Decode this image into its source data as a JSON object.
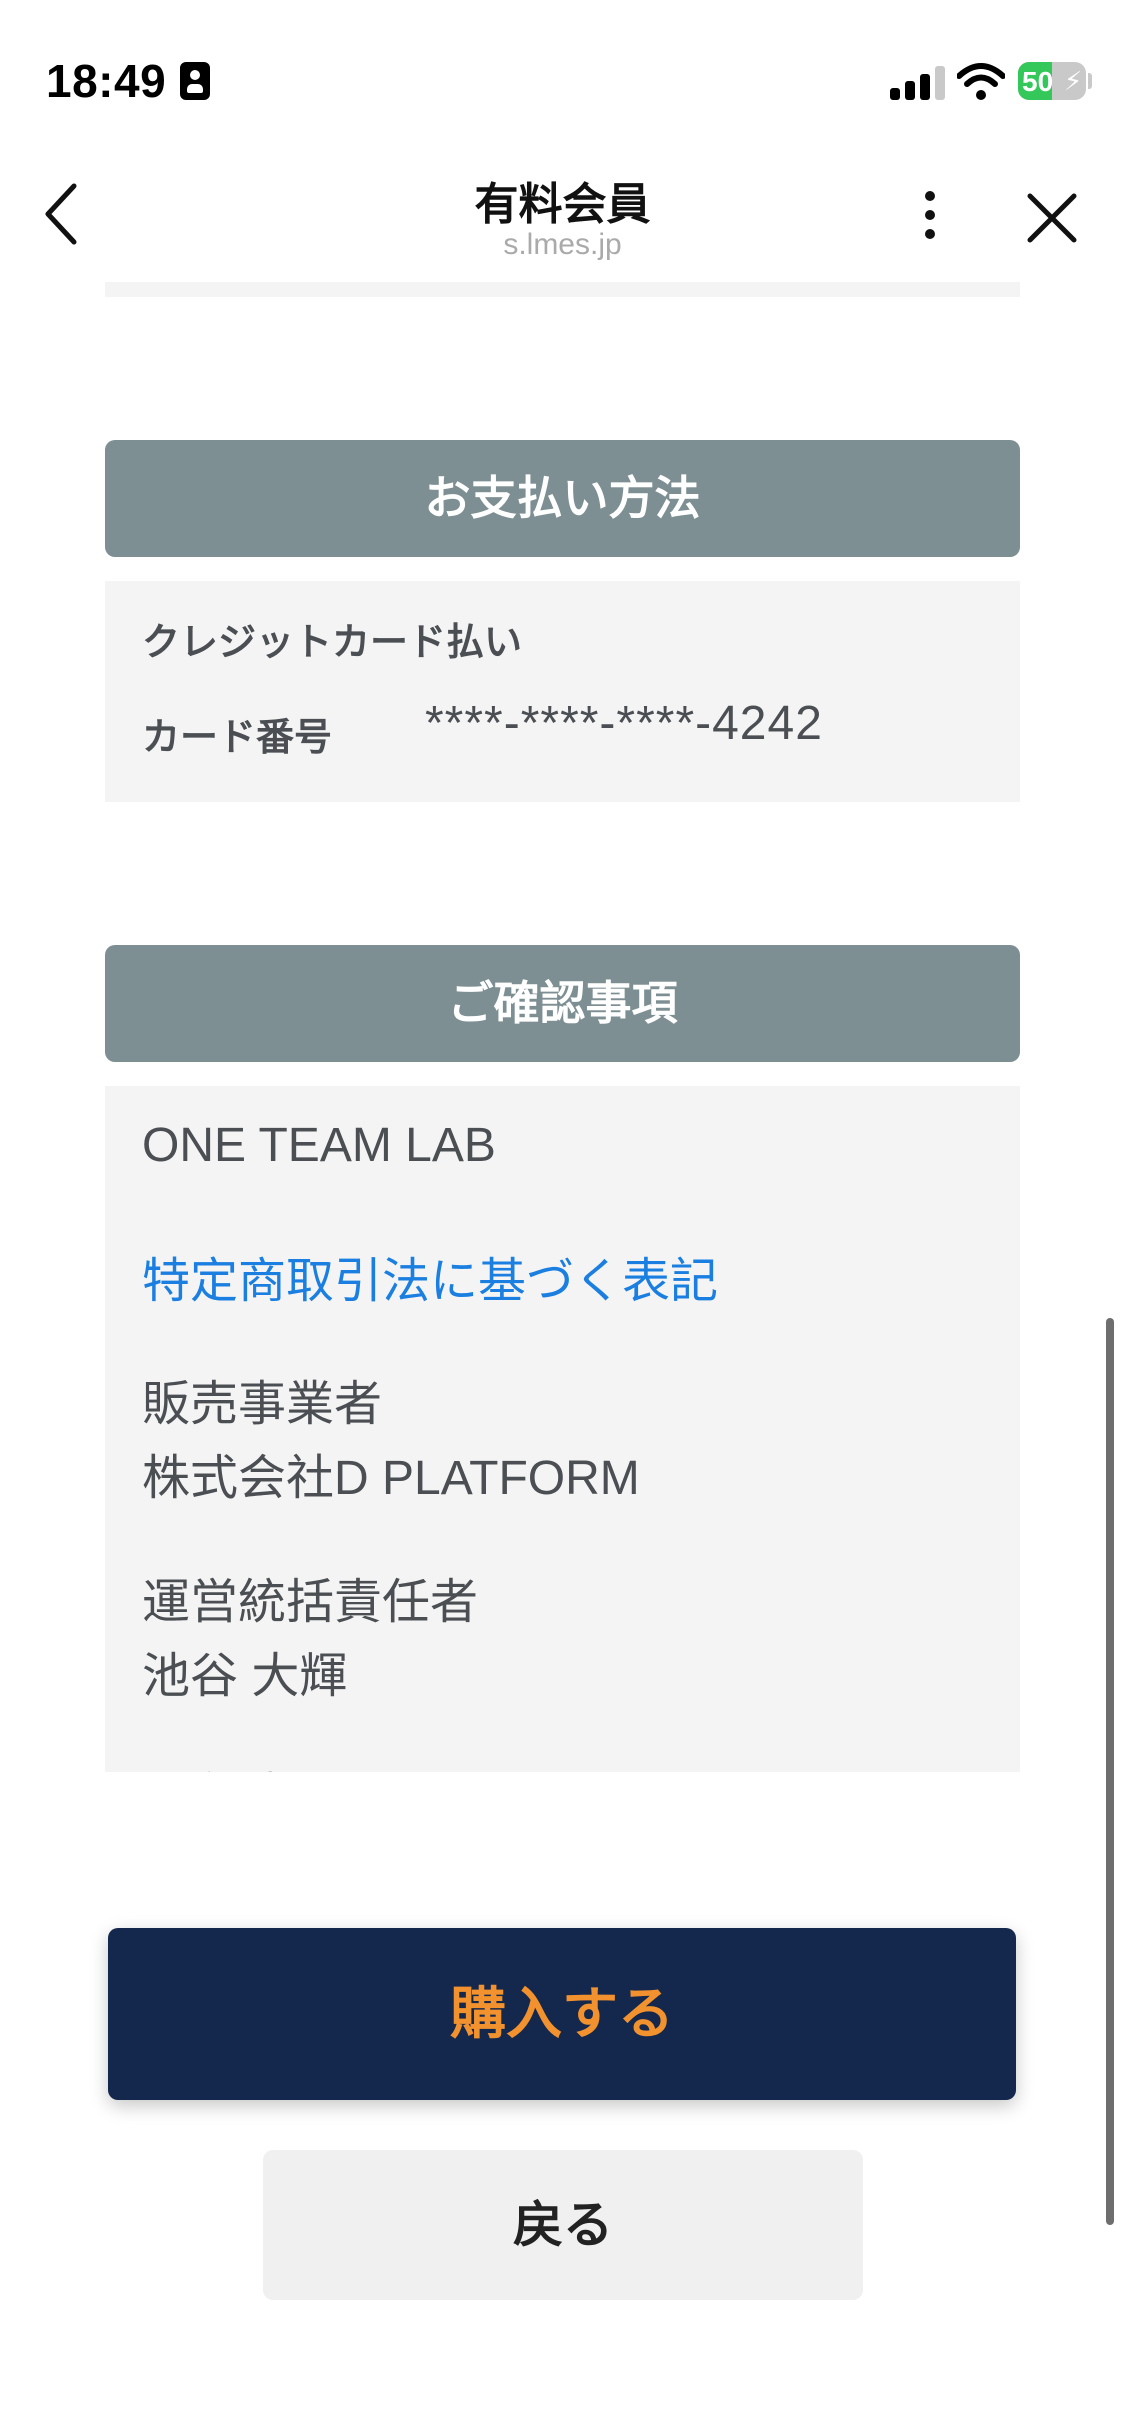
{
  "status_bar": {
    "time": "18:49",
    "battery_level": "50",
    "battery_fraction": 0.5
  },
  "nav": {
    "title": "有料会員",
    "url": "s.lmes.jp",
    "icons": [
      "chevron-left-icon",
      "more-vertical-icon",
      "close-icon"
    ]
  },
  "payment": {
    "header": "お支払い方法",
    "method": "クレジットカード払い",
    "card_label": "カード番号",
    "card_number": "****-****-****-4242"
  },
  "confirm": {
    "header": "ご確認事項",
    "company_name": "ONE TEAM LAB",
    "law_link": "特定商取引法に基づく表記",
    "seller_label": "販売事業者",
    "seller_value": "株式会社D PLATFORM",
    "manager_label": "運営統括責任者",
    "manager_value": "池谷 大輝",
    "address_label": "所在地"
  },
  "actions": {
    "buy_label": "購入する",
    "back_label": "戻る"
  },
  "colors": {
    "section_header": "#7d8f93",
    "panel_bg": "#f4f4f4",
    "buy_bg": "#14274c",
    "buy_text": "#f2922e",
    "link": "#1a7fe0"
  }
}
